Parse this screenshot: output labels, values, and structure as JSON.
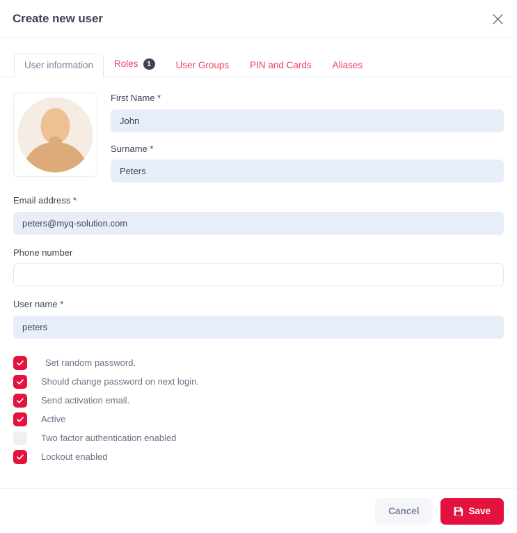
{
  "dialog": {
    "title": "Create new user",
    "close_icon": "close-icon"
  },
  "tabs": [
    {
      "label": "User information",
      "active": true,
      "badge": null
    },
    {
      "label": "Roles",
      "active": false,
      "badge": "1"
    },
    {
      "label": "User Groups",
      "active": false,
      "badge": null
    },
    {
      "label": "PIN and Cards",
      "active": false,
      "badge": null
    },
    {
      "label": "Aliases",
      "active": false,
      "badge": null
    }
  ],
  "avatar": {
    "icon": "user-avatar-placeholder-icon",
    "circle_color": "#f5ece3",
    "figure_color": "#efc596"
  },
  "form": {
    "first_name": {
      "label": "First Name *",
      "value": "John",
      "placeholder": ""
    },
    "surname": {
      "label": "Surname *",
      "value": "Peters",
      "placeholder": ""
    },
    "email": {
      "label": "Email address *",
      "value": "peters@myq-solution.com",
      "placeholder": ""
    },
    "phone": {
      "label": "Phone number",
      "value": "",
      "placeholder": ""
    },
    "user_name": {
      "label": "User name *",
      "value": "peters",
      "placeholder": ""
    }
  },
  "checkboxes": [
    {
      "label": "Set random password.",
      "checked": true,
      "indented": true
    },
    {
      "label": "Should change password on next login.",
      "checked": true,
      "indented": false
    },
    {
      "label": "Send activation email.",
      "checked": true,
      "indented": false
    },
    {
      "label": "Active",
      "checked": true,
      "indented": false
    },
    {
      "label": "Two factor authentication enabled",
      "checked": false,
      "indented": false
    },
    {
      "label": "Lockout enabled",
      "checked": true,
      "indented": false
    }
  ],
  "footer": {
    "cancel_label": "Cancel",
    "save_label": "Save",
    "save_icon": "save-floppy-icon"
  },
  "colors": {
    "accent_red": "#e4133d",
    "tab_red": "#ef4060",
    "input_fill": "#e8edfa",
    "title_text": "#3f4254",
    "muted_text": "#7e8299",
    "badge_bg": "#3f4254"
  }
}
